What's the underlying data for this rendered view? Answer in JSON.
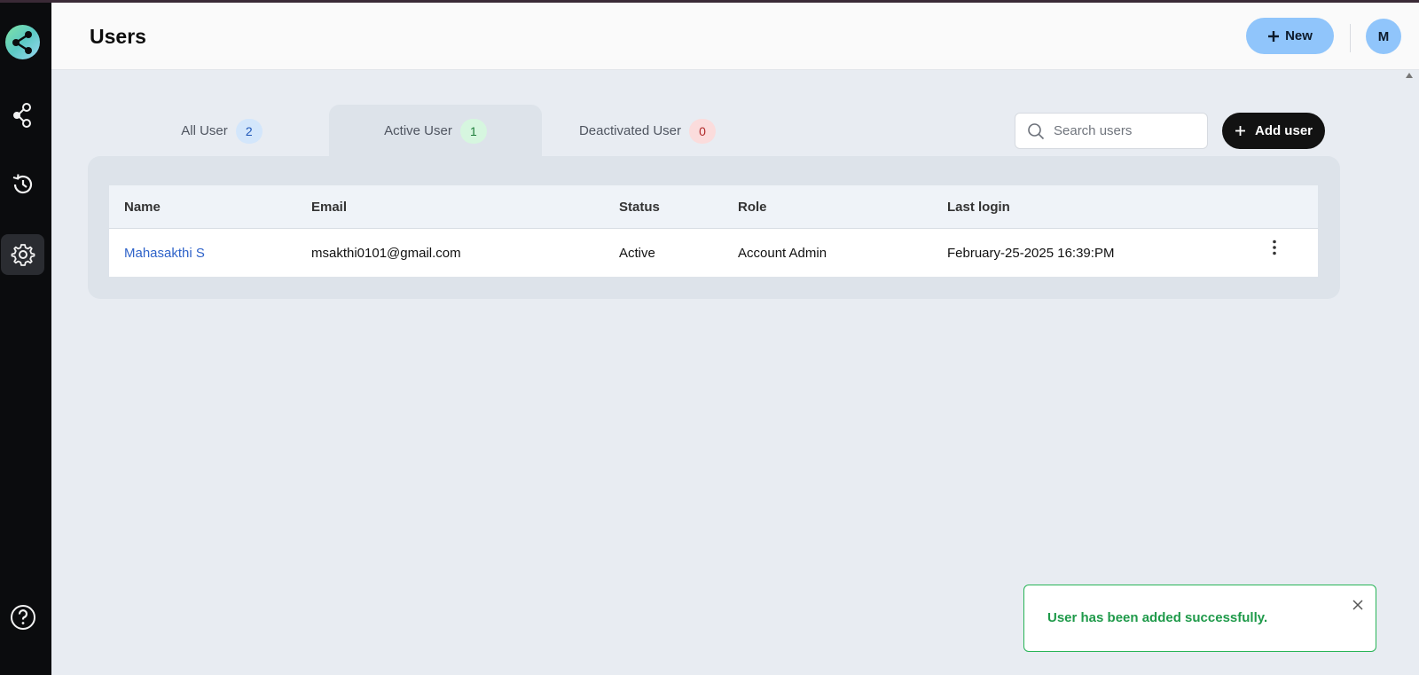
{
  "header": {
    "title": "Users",
    "new_label": "New",
    "avatar_initial": "M"
  },
  "tabs": [
    {
      "label": "All User",
      "count": "2"
    },
    {
      "label": "Active User",
      "count": "1"
    },
    {
      "label": "Deactivated User",
      "count": "0"
    }
  ],
  "search": {
    "placeholder": "Search users",
    "value": ""
  },
  "add_user_label": "Add user",
  "table": {
    "columns": [
      "Name",
      "Email",
      "Status",
      "Role",
      "Last login"
    ],
    "rows": [
      {
        "name": "Mahasakthi S",
        "email": "msakthi0101@gmail.com",
        "status": "Active",
        "role": "Account Admin",
        "last_login": "February-25-2025 16:39:PM"
      }
    ]
  },
  "toast": {
    "message": "User has been added successfully."
  },
  "colors": {
    "accent_blue": "#90c5fb",
    "sidebar": "#0b0c0e",
    "success": "#1f9a4a",
    "link": "#2f63c9"
  },
  "icons": {
    "logo": "share-logo-icon",
    "nav": [
      "share-icon",
      "history-icon",
      "gear-icon"
    ],
    "help": "help-icon"
  }
}
